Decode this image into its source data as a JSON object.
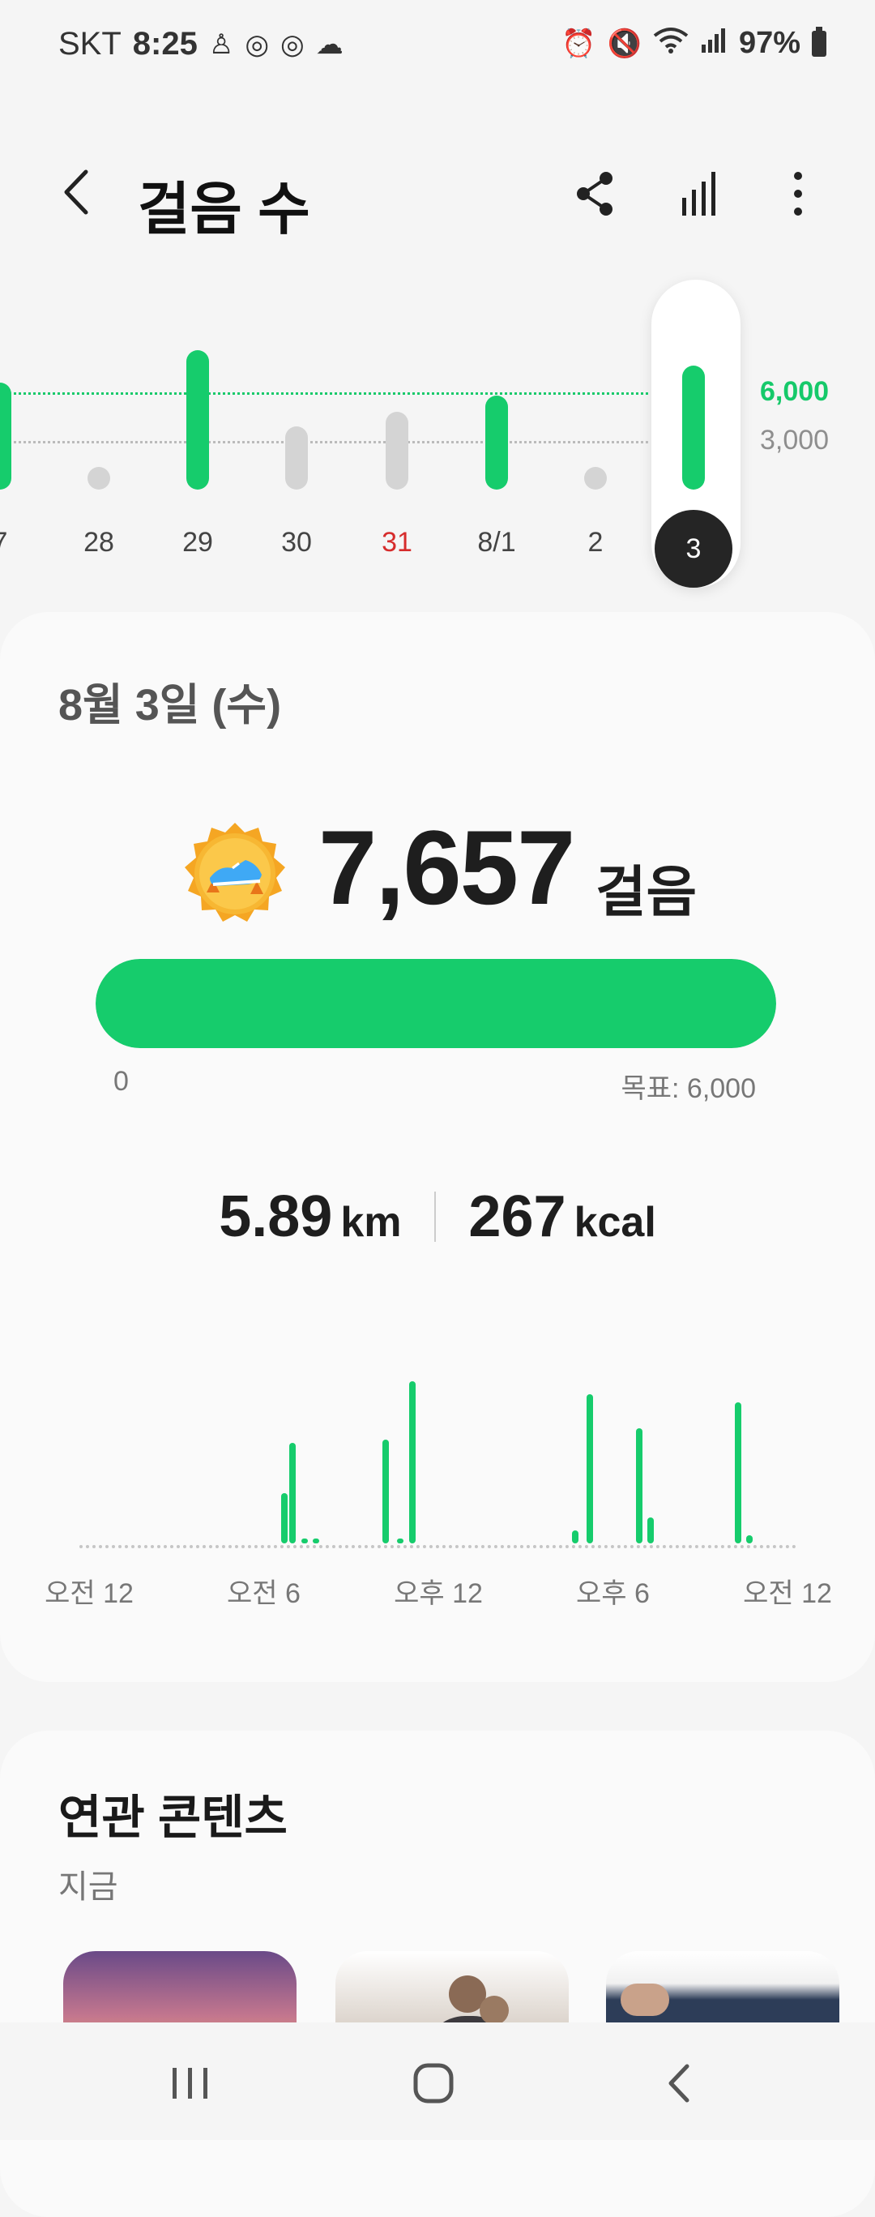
{
  "status_bar": {
    "carrier": "SKT",
    "time": "8:25",
    "battery": "97%"
  },
  "header": {
    "title": "걸음 수"
  },
  "week_chart": {
    "goal_label": "6,000",
    "base_label": "3,000",
    "days": [
      {
        "label": "7",
        "steps": 6600,
        "goal_met": true
      },
      {
        "label": "28",
        "steps": 700,
        "goal_met": false
      },
      {
        "label": "29",
        "steps": 8600,
        "goal_met": true
      },
      {
        "label": "30",
        "steps": 3900,
        "goal_met": false
      },
      {
        "label": "31",
        "steps": 4800,
        "goal_met": false,
        "holiday": true
      },
      {
        "label": "8/1",
        "steps": 5800,
        "goal_met": true
      },
      {
        "label": "2",
        "steps": 600,
        "goal_met": false
      },
      {
        "label": "3",
        "steps": 7657,
        "goal_met": true,
        "selected": true
      }
    ]
  },
  "summary": {
    "date": "8월 3일 (수)",
    "steps": "7,657",
    "steps_unit": "걸음",
    "progress_fraction": 1.0,
    "progress_min": "0",
    "progress_goal": "목표: 6,000",
    "distance": "5.89",
    "distance_unit": "km",
    "calories": "267",
    "calories_unit": "kcal"
  },
  "hourly_chart": {
    "labels": [
      "오전 12",
      "오전 6",
      "오후 12",
      "오후 6",
      "오전 12"
    ],
    "bars": [
      {
        "hour": 6.7,
        "level": 0.31
      },
      {
        "hour": 7.0,
        "level": 0.62
      },
      {
        "hour": 7.4,
        "level": 0.03
      },
      {
        "hour": 7.8,
        "level": 0.03
      },
      {
        "hour": 10.2,
        "level": 0.64
      },
      {
        "hour": 10.7,
        "level": 0.03
      },
      {
        "hour": 11.1,
        "level": 1.0
      },
      {
        "hour": 16.7,
        "level": 0.08
      },
      {
        "hour": 17.2,
        "level": 0.92
      },
      {
        "hour": 18.9,
        "level": 0.71
      },
      {
        "hour": 19.3,
        "level": 0.16
      },
      {
        "hour": 22.3,
        "level": 0.87
      },
      {
        "hour": 22.7,
        "level": 0.05
      }
    ]
  },
  "related": {
    "title": "연관 콘텐츠",
    "subtitle": "지금"
  },
  "colors": {
    "accent_green": "#16cc6c",
    "inactive_gray": "#d4d4d4",
    "holiday_red": "#d62c2c"
  }
}
